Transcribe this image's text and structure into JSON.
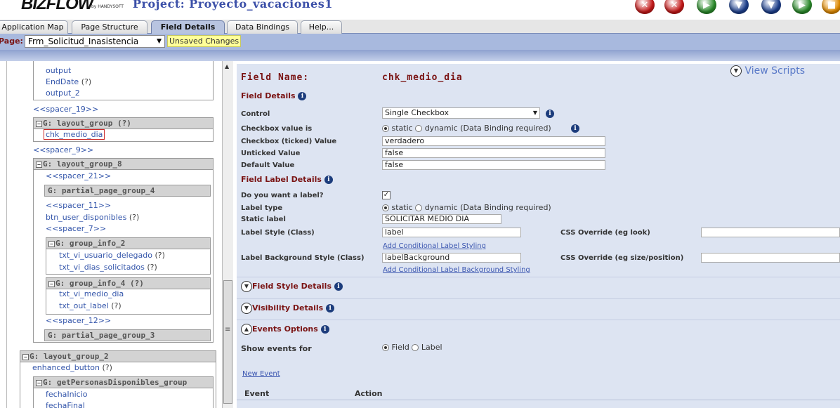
{
  "header": {
    "logo": "BIZFLOW",
    "logo_sub": "by HANDYSOFT",
    "project_title": "Project: Proyecto_vacaciones1",
    "toolbar_buttons": [
      {
        "icon": "close-red-icon",
        "color": "#c41818",
        "glyph": "✕"
      },
      {
        "icon": "close-all-red-icon",
        "color": "#c41818",
        "glyph": "✕"
      },
      {
        "icon": "run-green-icon",
        "color": "#2a8a2a",
        "glyph": "▶"
      },
      {
        "icon": "download-blue-icon",
        "color": "#1d3f8c",
        "glyph": "▼"
      },
      {
        "icon": "download-all-blue-icon",
        "color": "#1d3f8c",
        "glyph": "▼"
      },
      {
        "icon": "publish-green-icon",
        "color": "#2a8a2a",
        "glyph": "▶"
      },
      {
        "icon": "save-orange-icon",
        "color": "#e08a00",
        "glyph": "■"
      }
    ]
  },
  "tabs": [
    {
      "label": "Application Map",
      "active": false
    },
    {
      "label": "Page Structure",
      "active": false
    },
    {
      "label": "Field Details",
      "active": true
    },
    {
      "label": "Data Bindings",
      "active": false
    },
    {
      "label": "Help...",
      "active": false
    }
  ],
  "pagebar": {
    "label": "Page:",
    "selected_page": "Frm_Solicitud_Inasistencia",
    "unsaved": "Unsaved Changes"
  },
  "tree": {
    "group1_items": [
      "output",
      "EndDate",
      "output_2"
    ],
    "enddate_q": "(?)",
    "spacer_19": "<<spacer_19>>",
    "layout_group_head": "G: layout_group (?)",
    "selected_item": "chk_medio_dia",
    "spacer_9": "<<spacer_9>>",
    "layout_group_8_head": "G: layout_group_8",
    "spacer_21": "<<spacer_21>>",
    "partial_page_group_4": "G: partial_page_group_4",
    "spacer_11": "<<spacer_11>>",
    "btn_user_disponibles": "btn_user_disponibles",
    "btn_q": "(?)",
    "spacer_7": "<<spacer_7>>",
    "group_info_2_head": "G: group_info_2",
    "txt_vi_usuario_delegado": "txt_vi_usuario_delegado",
    "txt_vi_dias_solicitados": "txt_vi_dias_solicitados",
    "q": "(?)",
    "group_info_4_head": "G: group_info_4 (?)",
    "txt_vi_medio_dia": "txt_vi_medio_dia",
    "txt_out_label": "txt_out_label",
    "spacer_12": "<<spacer_12>>",
    "partial_page_group_3": "G: partial_page_group_3",
    "layout_group_2_head": "G: layout_group_2",
    "enhanced_button": "enhanced_button",
    "get_personas_head": "G: getPersonasDisponibles_group",
    "fecha_inicio": "fechaInicio",
    "fecha_final": "fechaFinal"
  },
  "details": {
    "view_scripts": "View Scripts",
    "field_name_label": "Field Name:",
    "field_name_value": "chk_medio_dia",
    "field_details": "Field Details",
    "control_label": "Control",
    "control_value": "Single Checkbox",
    "checkbox_value_is_label": "Checkbox value is",
    "static": "static",
    "dynamic": "dynamic (Data Binding required)",
    "ticked_label": "Checkbox (ticked) Value",
    "ticked_value": "verdadero",
    "unticked_label": "Unticked Value",
    "unticked_value": "false",
    "default_label": "Default Value",
    "default_value": "false",
    "field_label_details": "Field Label Details",
    "want_label": "Do you want a label?",
    "want_label_checked": true,
    "label_type": "Label type",
    "static_label_label": "Static label",
    "static_label_value": "SOLICITAR MEDIO DIA",
    "label_style_label": "Label Style (Class)",
    "label_style_value": "label",
    "css_override_look": "CSS Override (eg look)",
    "css_override_look_value": "",
    "add_cond_label": "Add Conditional Label Styling",
    "label_bg_label": "Label Background Style (Class)",
    "label_bg_value": "labelBackground",
    "css_override_size": "CSS Override (eg size/position)",
    "css_override_size_value": "",
    "add_cond_bg": "Add Conditional Label Background Styling",
    "field_style_details": "Field Style Details",
    "visibility_details": "Visibility Details",
    "events_options": "Events Options",
    "show_events_for": "Show events for",
    "field": "Field",
    "label": "Label",
    "new_event": "New Event",
    "event_col": "Event",
    "action_col": "Action"
  }
}
